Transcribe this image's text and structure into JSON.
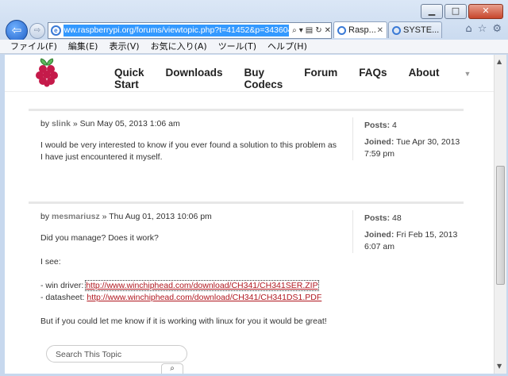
{
  "browser": {
    "url": "ww.raspberrypi.org/forums/viewtopic.php?t=41452&p=343604",
    "tabs": [
      {
        "label": "Rasp...",
        "active": true
      },
      {
        "label": "SYSTE...",
        "active": false
      }
    ],
    "caption": {
      "minimize": "▁",
      "maximize": "□",
      "close": "✕"
    }
  },
  "menu": [
    "ファイル(F)",
    "編集(E)",
    "表示(V)",
    "お気に入り(A)",
    "ツール(T)",
    "ヘルプ(H)"
  ],
  "site_nav": [
    "Quick Start",
    "Downloads",
    "Buy Codecs",
    "Forum",
    "FAQs",
    "About"
  ],
  "posts": [
    {
      "by": "by",
      "author": "slink",
      "date": "» Sun May 05, 2013 1:06 am",
      "body": "I would be very interested to know if you ever found a solution to this problem as I have just encountered it myself.",
      "posts_label": "Posts:",
      "posts_count": "4",
      "joined_label": "Joined:",
      "joined_date": "Tue Apr 30, 2013 7:59 pm"
    },
    {
      "by": "by",
      "author": "mesmariusz",
      "date": "» Thu Aug 01, 2013 10:06 pm",
      "line1": "Did you manage? Does it work?",
      "line2": "I see:",
      "driver_label": "- win driver:",
      "driver_link": "http://www.winchiphead.com/download/CH341/CH341SER.ZIP",
      "datasheet_label": "- datasheet:",
      "datasheet_link": "http://www.winchiphead.com/download/CH341/CH341DS1.PDF",
      "line3": "But if you could let me know if it is working with linux for you it would be great!",
      "posts_label": "Posts:",
      "posts_count": "48",
      "joined_label": "Joined:",
      "joined_date": "Fri Feb 15, 2013 6:07 am"
    }
  ],
  "search": {
    "placeholder": "Search This Topic"
  }
}
